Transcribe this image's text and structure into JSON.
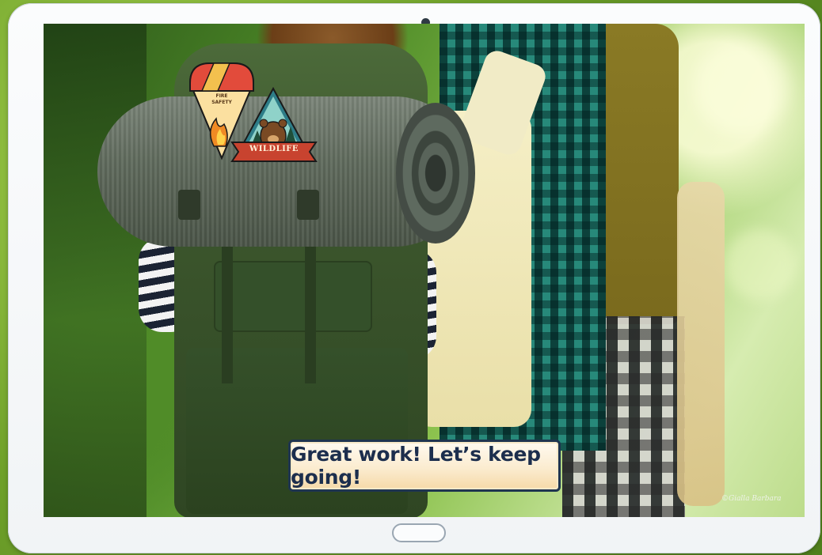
{
  "toast": {
    "message": "Great work! Let’s keep going!"
  },
  "badges": {
    "fire_safety": {
      "line1": "FIRE",
      "line2": "SAFETY"
    },
    "wildlife": {
      "label": "WILDLIFE"
    }
  },
  "credit": {
    "text": "©Gialla Barbara"
  },
  "colors": {
    "tablet_frame": "#f4f6f8",
    "toast_border": "#1f3550",
    "toast_text": "#1c2e4d",
    "backpack": "#3f5a2f",
    "mat": "#5f6a5c"
  }
}
